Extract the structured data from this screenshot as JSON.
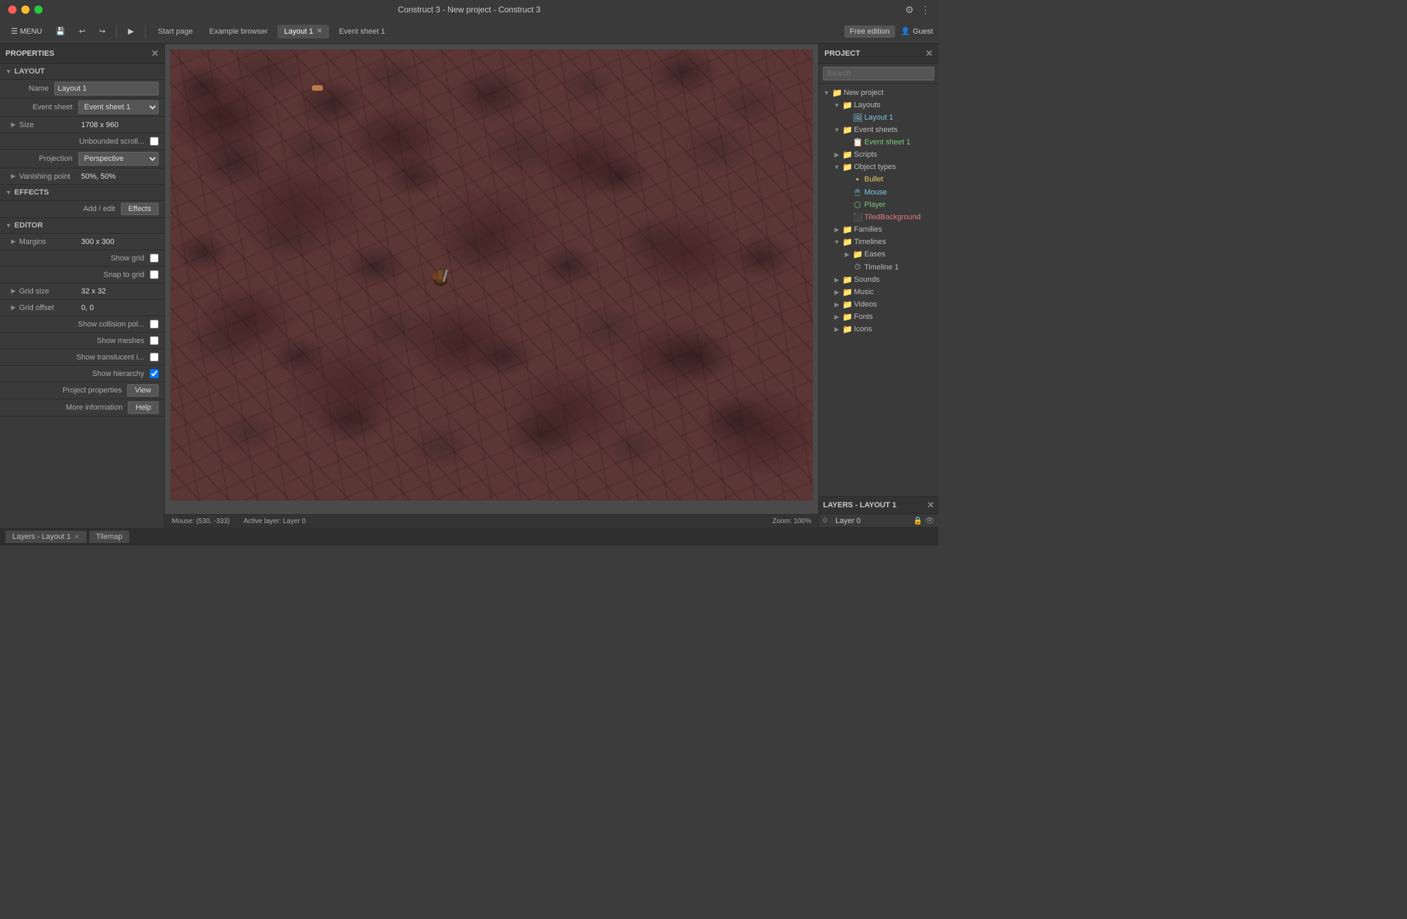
{
  "window": {
    "title": "Construct 3 - New project - Construct 3"
  },
  "toolbar": {
    "menu_label": "MENU",
    "tabs": [
      {
        "label": "Start page",
        "active": false,
        "closable": false
      },
      {
        "label": "Example browser",
        "active": false,
        "closable": false
      },
      {
        "label": "Layout 1",
        "active": true,
        "closable": true
      },
      {
        "label": "Event sheet 1",
        "active": false,
        "closable": false
      }
    ],
    "free_edition_label": "Free edition",
    "guest_label": "Guest"
  },
  "properties": {
    "panel_title": "PROPERTIES",
    "sections": {
      "layout": {
        "label": "LAYOUT",
        "fields": {
          "name_label": "Name",
          "name_value": "Layout 1",
          "event_sheet_label": "Event sheet",
          "event_sheet_value": "Event sheet 1",
          "size_label": "Size",
          "size_value": "1708 x 960",
          "unbounded_scroll_label": "Unbounded scroll...",
          "projection_label": "Projection",
          "projection_value": "Perspective",
          "vanishing_point_label": "Vanishing point",
          "vanishing_point_value": "50%, 50%"
        }
      },
      "effects": {
        "label": "EFFECTS",
        "add_edit_label": "Add / edit",
        "effects_btn_label": "Effects"
      },
      "editor": {
        "label": "EDITOR",
        "fields": {
          "margins_label": "Margins",
          "margins_value": "300 x 300",
          "show_grid_label": "Show grid",
          "snap_to_grid_label": "Snap to grid",
          "grid_size_label": "Grid size",
          "grid_size_value": "32 x 32",
          "grid_offset_label": "Grid offset",
          "grid_offset_value": "0, 0",
          "show_collision_label": "Show collision pol...",
          "show_meshes_label": "Show meshes",
          "show_translucent_label": "Show translucent i...",
          "show_hierarchy_label": "Show hierarchy",
          "project_properties_label": "Project properties",
          "project_properties_btn": "View",
          "more_info_label": "More information",
          "more_info_btn": "Help"
        }
      }
    }
  },
  "project_panel": {
    "title": "PROJECT",
    "search_placeholder": "Search",
    "tree": [
      {
        "indent": 0,
        "type": "folder",
        "label": "New project",
        "expanded": true
      },
      {
        "indent": 1,
        "type": "folder",
        "label": "Layouts",
        "expanded": true,
        "color": "normal"
      },
      {
        "indent": 2,
        "type": "layout",
        "label": "Layout 1",
        "color": "cyan"
      },
      {
        "indent": 1,
        "type": "folder",
        "label": "Event sheets",
        "expanded": true,
        "color": "normal"
      },
      {
        "indent": 2,
        "type": "event_sheet",
        "label": "Event sheet 1",
        "color": "green"
      },
      {
        "indent": 1,
        "type": "folder",
        "label": "Scripts",
        "expanded": false,
        "color": "normal"
      },
      {
        "indent": 1,
        "type": "folder",
        "label": "Object types",
        "expanded": true,
        "color": "normal"
      },
      {
        "indent": 2,
        "type": "object",
        "label": "Bullet",
        "color": "yellow"
      },
      {
        "indent": 2,
        "type": "object",
        "label": "Mouse",
        "color": "cyan"
      },
      {
        "indent": 2,
        "type": "object",
        "label": "Player",
        "color": "green"
      },
      {
        "indent": 2,
        "type": "object",
        "label": "TiledBackground",
        "color": "red"
      },
      {
        "indent": 1,
        "type": "folder",
        "label": "Families",
        "expanded": false,
        "color": "normal"
      },
      {
        "indent": 1,
        "type": "folder",
        "label": "Timelines",
        "expanded": true,
        "color": "normal"
      },
      {
        "indent": 2,
        "type": "folder",
        "label": "Eases",
        "expanded": false,
        "color": "normal"
      },
      {
        "indent": 2,
        "type": "timeline",
        "label": "Timeline 1",
        "color": "normal"
      },
      {
        "indent": 1,
        "type": "folder",
        "label": "Sounds",
        "expanded": false,
        "color": "normal"
      },
      {
        "indent": 1,
        "type": "folder",
        "label": "Music",
        "expanded": false,
        "color": "normal"
      },
      {
        "indent": 1,
        "type": "folder",
        "label": "Videos",
        "expanded": false,
        "color": "normal"
      },
      {
        "indent": 1,
        "type": "folder",
        "label": "Fonts",
        "expanded": false,
        "color": "normal"
      },
      {
        "indent": 1,
        "type": "folder",
        "label": "Icons",
        "expanded": false,
        "color": "normal"
      }
    ]
  },
  "layers_panel": {
    "title": "LAYERS - LAYOUT 1",
    "layers": [
      {
        "num": "0",
        "name": "Layer 0"
      }
    ]
  },
  "canvas": {
    "status": {
      "mouse": "Mouse: (530, -333)",
      "active_layer": "Active layer: Layer 0",
      "zoom": "Zoom: 100%"
    }
  },
  "bottom_tabs": [
    {
      "label": "Layers - Layout 1",
      "closable": true
    },
    {
      "label": "Tilemap",
      "closable": false
    }
  ],
  "icons": {
    "folder": "📁",
    "layout": "🖼",
    "event_sheet": "📋",
    "object": "⬡",
    "timeline": "⏱",
    "lock": "🔒",
    "eye": "👁",
    "chevron_down": "▼",
    "chevron_right": "▶",
    "arrow_left": "←",
    "arrow_right": "→",
    "play": "▶",
    "undo": "↩",
    "redo": "↪",
    "save": "💾",
    "gear": "⚙",
    "menu_dots": "⋮"
  }
}
